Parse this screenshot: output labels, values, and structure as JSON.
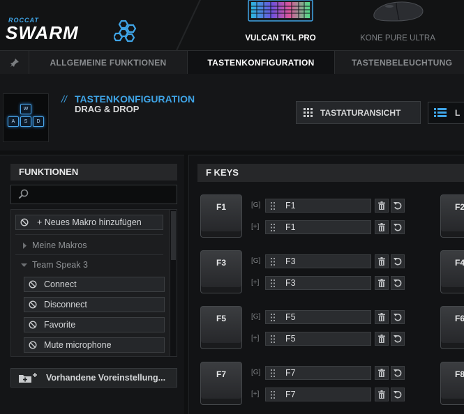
{
  "header": {
    "logo_small": "ROCCAT",
    "logo_big": "SWARM",
    "devices": [
      {
        "label": "VULCAN TKL PRO",
        "active": true
      },
      {
        "label": "KONE PURE ULTRA",
        "active": false
      }
    ]
  },
  "tabs": [
    {
      "label": "ALLGEMEINE FUNKTIONEN",
      "active": false
    },
    {
      "label": "TASTENKONFIGURATION",
      "active": true
    },
    {
      "label": "TASTENBELEUCHTUNG",
      "active": false
    }
  ],
  "page": {
    "slash": "//",
    "title": "TASTENKONFIGURATION",
    "subtitle": "DRAG & DROP",
    "wasd": [
      "W",
      "A",
      "S",
      "D"
    ],
    "view_button": "TASTATURANSICHT",
    "list_button": "L"
  },
  "functions": {
    "heading": "FUNKTIONEN",
    "search_placeholder": "",
    "add_macro": "+ Neues Makro hinzufügen",
    "group_my_macros": "Meine Makros",
    "group_teamspeak": "Team Speak 3",
    "items": [
      "Connect",
      "Disconnect",
      "Favorite",
      "Mute microphone"
    ],
    "presets_button": "Vorhandene Voreinstellung..."
  },
  "fkeys": {
    "heading": "F KEYS",
    "tag_g": "[G]",
    "tag_plus": "[+]",
    "rows": [
      {
        "key": "F1",
        "g": "F1",
        "plus": "F1",
        "next": "F2"
      },
      {
        "key": "F3",
        "g": "F3",
        "plus": "F3",
        "next": "F4"
      },
      {
        "key": "F5",
        "g": "F5",
        "plus": "F5",
        "next": "F6"
      },
      {
        "key": "F7",
        "g": "F7",
        "plus": "F7",
        "next": "F8"
      }
    ]
  },
  "colors": {
    "accent": "#3fa4e6",
    "background": "#0f1011",
    "panel": "#141517"
  }
}
